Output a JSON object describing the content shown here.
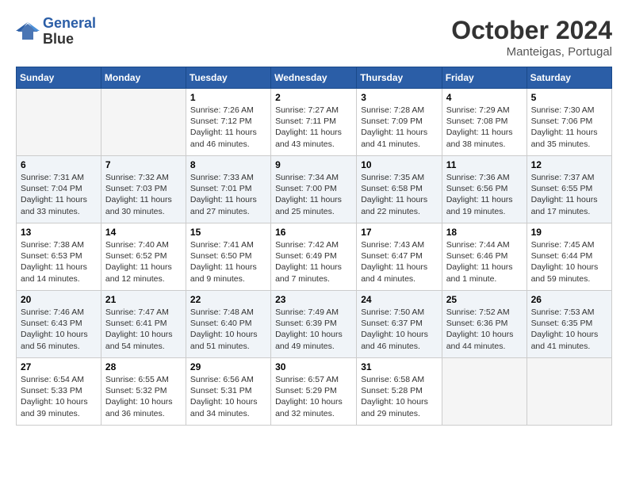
{
  "header": {
    "logo_line1": "General",
    "logo_line2": "Blue",
    "month": "October 2024",
    "location": "Manteigas, Portugal"
  },
  "weekdays": [
    "Sunday",
    "Monday",
    "Tuesday",
    "Wednesday",
    "Thursday",
    "Friday",
    "Saturday"
  ],
  "weeks": [
    [
      {
        "day": "",
        "info": ""
      },
      {
        "day": "",
        "info": ""
      },
      {
        "day": "1",
        "info": "Sunrise: 7:26 AM\nSunset: 7:12 PM\nDaylight: 11 hours and 46 minutes."
      },
      {
        "day": "2",
        "info": "Sunrise: 7:27 AM\nSunset: 7:11 PM\nDaylight: 11 hours and 43 minutes."
      },
      {
        "day": "3",
        "info": "Sunrise: 7:28 AM\nSunset: 7:09 PM\nDaylight: 11 hours and 41 minutes."
      },
      {
        "day": "4",
        "info": "Sunrise: 7:29 AM\nSunset: 7:08 PM\nDaylight: 11 hours and 38 minutes."
      },
      {
        "day": "5",
        "info": "Sunrise: 7:30 AM\nSunset: 7:06 PM\nDaylight: 11 hours and 35 minutes."
      }
    ],
    [
      {
        "day": "6",
        "info": "Sunrise: 7:31 AM\nSunset: 7:04 PM\nDaylight: 11 hours and 33 minutes."
      },
      {
        "day": "7",
        "info": "Sunrise: 7:32 AM\nSunset: 7:03 PM\nDaylight: 11 hours and 30 minutes."
      },
      {
        "day": "8",
        "info": "Sunrise: 7:33 AM\nSunset: 7:01 PM\nDaylight: 11 hours and 27 minutes."
      },
      {
        "day": "9",
        "info": "Sunrise: 7:34 AM\nSunset: 7:00 PM\nDaylight: 11 hours and 25 minutes."
      },
      {
        "day": "10",
        "info": "Sunrise: 7:35 AM\nSunset: 6:58 PM\nDaylight: 11 hours and 22 minutes."
      },
      {
        "day": "11",
        "info": "Sunrise: 7:36 AM\nSunset: 6:56 PM\nDaylight: 11 hours and 19 minutes."
      },
      {
        "day": "12",
        "info": "Sunrise: 7:37 AM\nSunset: 6:55 PM\nDaylight: 11 hours and 17 minutes."
      }
    ],
    [
      {
        "day": "13",
        "info": "Sunrise: 7:38 AM\nSunset: 6:53 PM\nDaylight: 11 hours and 14 minutes."
      },
      {
        "day": "14",
        "info": "Sunrise: 7:40 AM\nSunset: 6:52 PM\nDaylight: 11 hours and 12 minutes."
      },
      {
        "day": "15",
        "info": "Sunrise: 7:41 AM\nSunset: 6:50 PM\nDaylight: 11 hours and 9 minutes."
      },
      {
        "day": "16",
        "info": "Sunrise: 7:42 AM\nSunset: 6:49 PM\nDaylight: 11 hours and 7 minutes."
      },
      {
        "day": "17",
        "info": "Sunrise: 7:43 AM\nSunset: 6:47 PM\nDaylight: 11 hours and 4 minutes."
      },
      {
        "day": "18",
        "info": "Sunrise: 7:44 AM\nSunset: 6:46 PM\nDaylight: 11 hours and 1 minute."
      },
      {
        "day": "19",
        "info": "Sunrise: 7:45 AM\nSunset: 6:44 PM\nDaylight: 10 hours and 59 minutes."
      }
    ],
    [
      {
        "day": "20",
        "info": "Sunrise: 7:46 AM\nSunset: 6:43 PM\nDaylight: 10 hours and 56 minutes."
      },
      {
        "day": "21",
        "info": "Sunrise: 7:47 AM\nSunset: 6:41 PM\nDaylight: 10 hours and 54 minutes."
      },
      {
        "day": "22",
        "info": "Sunrise: 7:48 AM\nSunset: 6:40 PM\nDaylight: 10 hours and 51 minutes."
      },
      {
        "day": "23",
        "info": "Sunrise: 7:49 AM\nSunset: 6:39 PM\nDaylight: 10 hours and 49 minutes."
      },
      {
        "day": "24",
        "info": "Sunrise: 7:50 AM\nSunset: 6:37 PM\nDaylight: 10 hours and 46 minutes."
      },
      {
        "day": "25",
        "info": "Sunrise: 7:52 AM\nSunset: 6:36 PM\nDaylight: 10 hours and 44 minutes."
      },
      {
        "day": "26",
        "info": "Sunrise: 7:53 AM\nSunset: 6:35 PM\nDaylight: 10 hours and 41 minutes."
      }
    ],
    [
      {
        "day": "27",
        "info": "Sunrise: 6:54 AM\nSunset: 5:33 PM\nDaylight: 10 hours and 39 minutes."
      },
      {
        "day": "28",
        "info": "Sunrise: 6:55 AM\nSunset: 5:32 PM\nDaylight: 10 hours and 36 minutes."
      },
      {
        "day": "29",
        "info": "Sunrise: 6:56 AM\nSunset: 5:31 PM\nDaylight: 10 hours and 34 minutes."
      },
      {
        "day": "30",
        "info": "Sunrise: 6:57 AM\nSunset: 5:29 PM\nDaylight: 10 hours and 32 minutes."
      },
      {
        "day": "31",
        "info": "Sunrise: 6:58 AM\nSunset: 5:28 PM\nDaylight: 10 hours and 29 minutes."
      },
      {
        "day": "",
        "info": ""
      },
      {
        "day": "",
        "info": ""
      }
    ]
  ]
}
